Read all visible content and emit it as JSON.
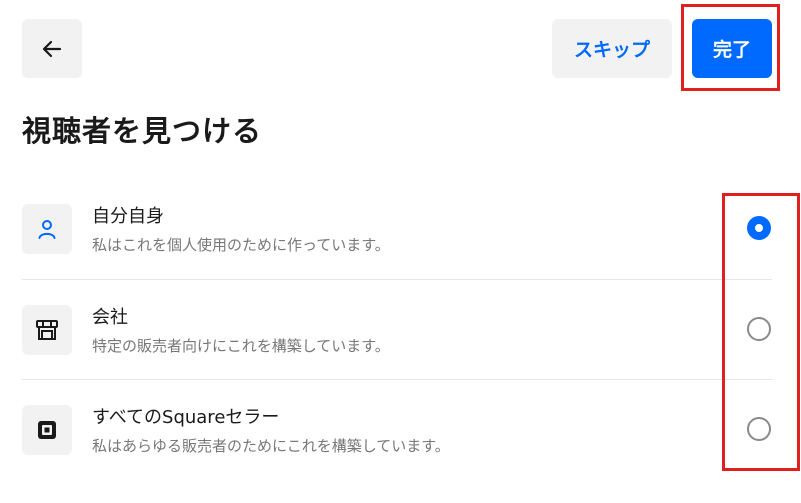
{
  "header": {
    "back_icon": "arrow-left-icon",
    "skip_label": "スキップ",
    "done_label": "完了"
  },
  "title": "視聴者を見つける",
  "options": [
    {
      "icon": "person-icon",
      "title": "自分自身",
      "description": "私はこれを個人使用のために作っています。",
      "selected": true
    },
    {
      "icon": "storefront-icon",
      "title": "会社",
      "description": "特定の販売者向けにこれを構築しています。",
      "selected": false
    },
    {
      "icon": "square-logo-icon",
      "title": "すべてのSquareセラー",
      "description": "私はあらゆる販売者のためにこれを構築しています。",
      "selected": false
    }
  ],
  "colors": {
    "accent": "#006aff",
    "highlight": "#e02020"
  }
}
